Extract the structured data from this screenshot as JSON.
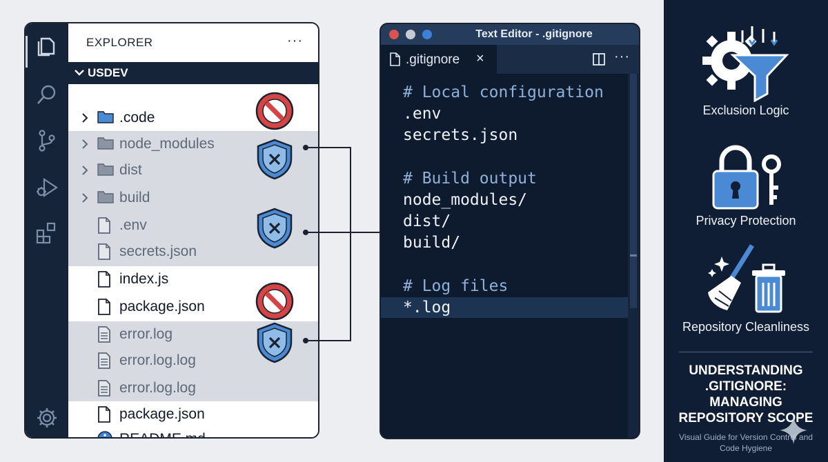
{
  "explorer": {
    "header": "EXPLORER",
    "more": "···",
    "root_folder": "USDEV",
    "items": [
      {
        "label": ".code",
        "type": "folder-blue",
        "ignored": false
      },
      {
        "label": "node_modules",
        "type": "folder",
        "ignored": true
      },
      {
        "label": "dist",
        "type": "folder",
        "ignored": true
      },
      {
        "label": "build",
        "type": "folder",
        "ignored": true
      },
      {
        "label": ".env",
        "type": "file",
        "ignored": true
      },
      {
        "label": "secrets.json",
        "type": "file",
        "ignored": true
      },
      {
        "label": "index.js",
        "type": "file",
        "ignored": false
      },
      {
        "label": "package.json",
        "type": "file",
        "ignored": false
      },
      {
        "label": "error.log",
        "type": "log",
        "ignored": true
      },
      {
        "label": "error.log.log",
        "type": "log",
        "ignored": true
      },
      {
        "label": "error.log.log",
        "type": "log",
        "ignored": true
      },
      {
        "label": "package.json",
        "type": "file",
        "ignored": false
      },
      {
        "label": "README.md",
        "type": "info",
        "ignored": false
      }
    ],
    "activity_icons": [
      "files-icon",
      "search-icon",
      "source-control-icon",
      "run-debug-icon",
      "extensions-icon",
      "settings-gear-icon"
    ]
  },
  "editor": {
    "window_title": "Text Editor - .gitignore",
    "tab_label": ".gitignore",
    "tab_close": "×",
    "more": "···",
    "code_lines": [
      {
        "text": "# Local configuration",
        "kind": "comment"
      },
      {
        "text": ".env",
        "kind": "code"
      },
      {
        "text": "secrets.json",
        "kind": "code"
      },
      {
        "text": "",
        "kind": "blank"
      },
      {
        "text": "# Build output",
        "kind": "comment"
      },
      {
        "text": "node_modules/",
        "kind": "code"
      },
      {
        "text": "dist/",
        "kind": "code"
      },
      {
        "text": "build/",
        "kind": "code"
      },
      {
        "text": "",
        "kind": "blank"
      },
      {
        "text": "# Log files",
        "kind": "comment"
      },
      {
        "text": "*.log",
        "kind": "code"
      }
    ],
    "highlighted_line_index": 10,
    "traffic_light_colors": [
      "#d9534f",
      "#c7ccd4",
      "#3b82d6"
    ]
  },
  "info_panel": {
    "concepts": [
      {
        "label": "Exclusion Logic",
        "icon": "gear-funnel-icon"
      },
      {
        "label": "Privacy Protection",
        "icon": "lock-key-icon"
      },
      {
        "label": "Repository Cleanliness",
        "icon": "broom-trash-icon"
      }
    ],
    "title": "UNDERSTANDING .GITIGNORE: MANAGING REPOSITORY SCOPE",
    "subtitle": "Visual Guide for Version Control and Code Hygiene"
  },
  "colors": {
    "navy": "#0f1e34",
    "accent_blue": "#4a8ad4",
    "block_red": "#d64545",
    "ignored_row": "#d7dbe1"
  }
}
